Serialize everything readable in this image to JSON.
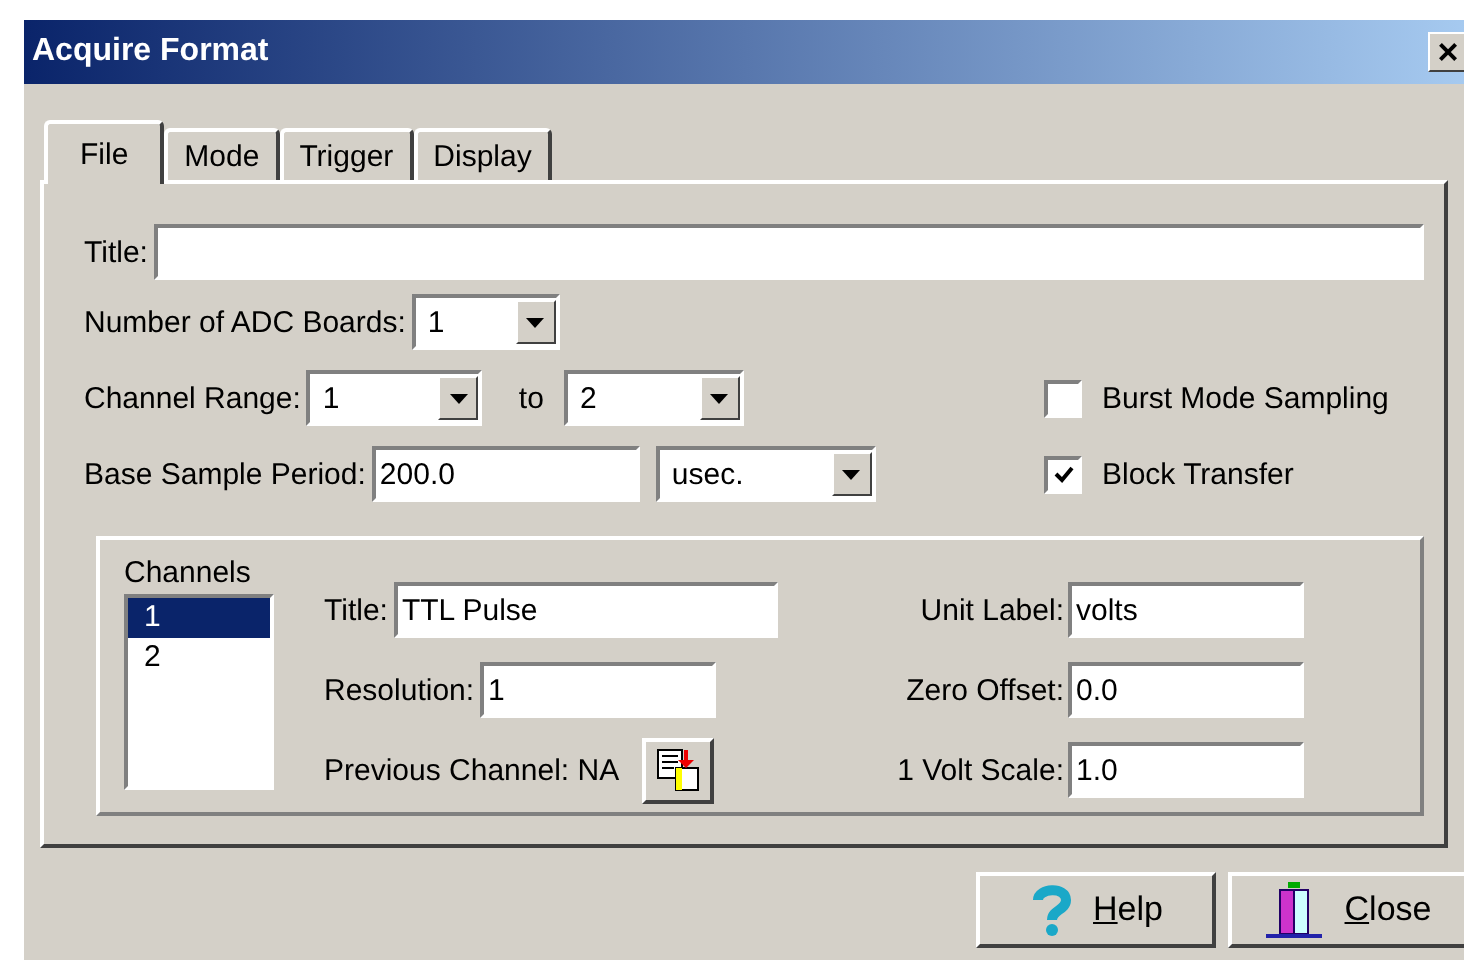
{
  "window": {
    "title": "Acquire Format",
    "close": "×"
  },
  "tabs": [
    {
      "label": "File",
      "selected": true
    },
    {
      "label": "Mode",
      "selected": false
    },
    {
      "label": "Trigger",
      "selected": false
    },
    {
      "label": "Display",
      "selected": false
    }
  ],
  "file": {
    "title_label": "Title:",
    "adc_label": "Number of ADC Boards:",
    "adc_value": "1",
    "range_label": "Channel Range:",
    "range_from": "1",
    "range_to_label": "to",
    "range_to": "2",
    "period_label": "Base Sample Period:",
    "period_value": "200.0",
    "period_unit": "usec.",
    "checkboxes": [
      {
        "label": "Burst Mode Sampling",
        "checked": false
      },
      {
        "label": "Block Transfer",
        "checked": true
      }
    ]
  },
  "channels": {
    "label": "Channels",
    "items": [
      {
        "label": "1",
        "selected": true
      },
      {
        "label": "2",
        "selected": false
      }
    ],
    "title_label": "Title:",
    "title_value": "TTL Pulse",
    "resolution_label": "Resolution:",
    "resolution_value": "1",
    "previous_label": "Previous Channel: NA",
    "unit_label": "Unit Label:",
    "unit_value": "volts",
    "offset_label": "Zero Offset:",
    "offset_value": "0.0",
    "scale_label": "1 Volt Scale:",
    "scale_value": "1.0"
  },
  "buttons": [
    {
      "kind": "help",
      "label": "Help",
      "underline_first": true
    },
    {
      "kind": "close",
      "label": "Close",
      "underline_first": true
    }
  ]
}
